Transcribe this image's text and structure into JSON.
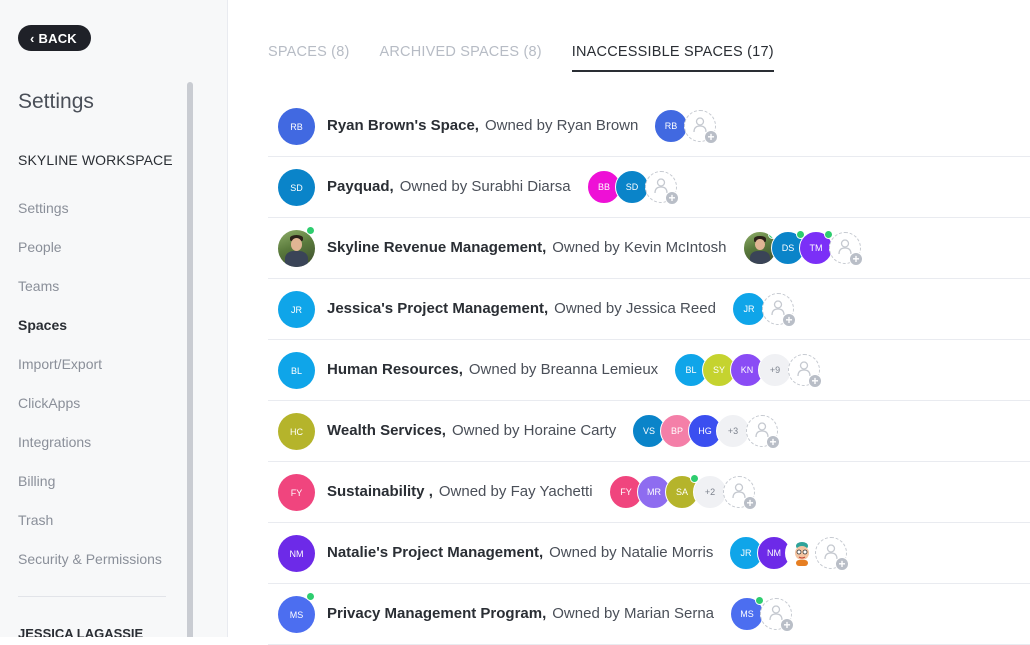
{
  "sidebar": {
    "back_label": "BACK",
    "title": "Settings",
    "workspace_name": "SKYLINE WORKSPACE",
    "nav_items": [
      {
        "label": "Settings",
        "active": false
      },
      {
        "label": "People",
        "active": false
      },
      {
        "label": "Teams",
        "active": false
      },
      {
        "label": "Spaces",
        "active": true
      },
      {
        "label": "Import/Export",
        "active": false
      },
      {
        "label": "ClickApps",
        "active": false
      },
      {
        "label": "Integrations",
        "active": false
      },
      {
        "label": "Billing",
        "active": false
      },
      {
        "label": "Trash",
        "active": false
      },
      {
        "label": "Security & Permissions",
        "active": false
      }
    ],
    "user_name": "JESSICA LAGASSIE"
  },
  "tabs": [
    {
      "label": "SPACES (8)",
      "active": false
    },
    {
      "label": "ARCHIVED SPACES (8)",
      "active": false
    },
    {
      "label": "INACCESSIBLE SPACES (17)",
      "active": true
    }
  ],
  "spaces": [
    {
      "name": "Ryan Brown's Space,",
      "owner": "Owned by Ryan Brown",
      "avatar": {
        "initials": "RB",
        "color": "#4169e1"
      },
      "members": [
        {
          "initials": "RB",
          "color": "#4169e1"
        }
      ]
    },
    {
      "name": "Payquad,",
      "owner": "Owned by Surabhi Diarsa",
      "avatar": {
        "initials": "SD",
        "color": "#0a84c9"
      },
      "members": [
        {
          "initials": "BB",
          "color": "#ee10d6"
        },
        {
          "initials": "SD",
          "color": "#0a84c9"
        }
      ]
    },
    {
      "name": "Skyline Revenue Management,",
      "owner": "Owned by Kevin McIntosh",
      "avatar": {
        "initials": "",
        "color": "photo",
        "online": true
      },
      "members": [
        {
          "initials": "",
          "color": "photo",
          "online": true
        },
        {
          "initials": "DS",
          "color": "#0a84c9",
          "online": true
        },
        {
          "initials": "TM",
          "color": "#7b2ff7",
          "online": true
        }
      ]
    },
    {
      "name": "Jessica's Project Management,",
      "owner": "Owned by Jessica Reed",
      "avatar": {
        "initials": "JR",
        "color": "#0fa5e9"
      },
      "members": [
        {
          "initials": "JR",
          "color": "#0fa5e9"
        }
      ]
    },
    {
      "name": "Human Resources,",
      "owner": "Owned by Breanna Lemieux",
      "avatar": {
        "initials": "BL",
        "color": "#0fa5e9"
      },
      "members": [
        {
          "initials": "BL",
          "color": "#0fa5e9"
        },
        {
          "initials": "SY",
          "color": "#c5d32f"
        },
        {
          "initials": "KN",
          "color": "#8a4cf5"
        },
        {
          "initials": "+9",
          "color": "more"
        }
      ]
    },
    {
      "name": "Wealth Services,",
      "owner": "Owned by Horaine Carty",
      "avatar": {
        "initials": "HC",
        "color": "#b5b42b"
      },
      "members": [
        {
          "initials": "VS",
          "color": "#0a84c9"
        },
        {
          "initials": "BP",
          "color": "#f47fa8"
        },
        {
          "initials": "HG",
          "color": "#3b4ff0"
        },
        {
          "initials": "+3",
          "color": "more"
        }
      ]
    },
    {
      "name": "Sustainability ,",
      "owner": "Owned by Fay Yachetti",
      "avatar": {
        "initials": "FY",
        "color": "#f0457e"
      },
      "members": [
        {
          "initials": "FY",
          "color": "#f0457e"
        },
        {
          "initials": "MR",
          "color": "#8e6cf0"
        },
        {
          "initials": "SA",
          "color": "#b5b42b",
          "online": true
        },
        {
          "initials": "+2",
          "color": "more"
        }
      ]
    },
    {
      "name": "Natalie's Project Management,",
      "owner": "Owned by Natalie Morris",
      "avatar": {
        "initials": "NM",
        "color": "#6d2ae8"
      },
      "members": [
        {
          "initials": "JR",
          "color": "#0fa5e9"
        },
        {
          "initials": "NM",
          "color": "#6d2ae8"
        },
        {
          "initials": "",
          "color": "emoji"
        }
      ]
    },
    {
      "name": "Privacy Management Program,",
      "owner": "Owned by Marian Serna",
      "avatar": {
        "initials": "MS",
        "color": "#4c6ef0",
        "online": true
      },
      "members": [
        {
          "initials": "MS",
          "color": "#4c6ef0",
          "online": true
        }
      ]
    }
  ]
}
